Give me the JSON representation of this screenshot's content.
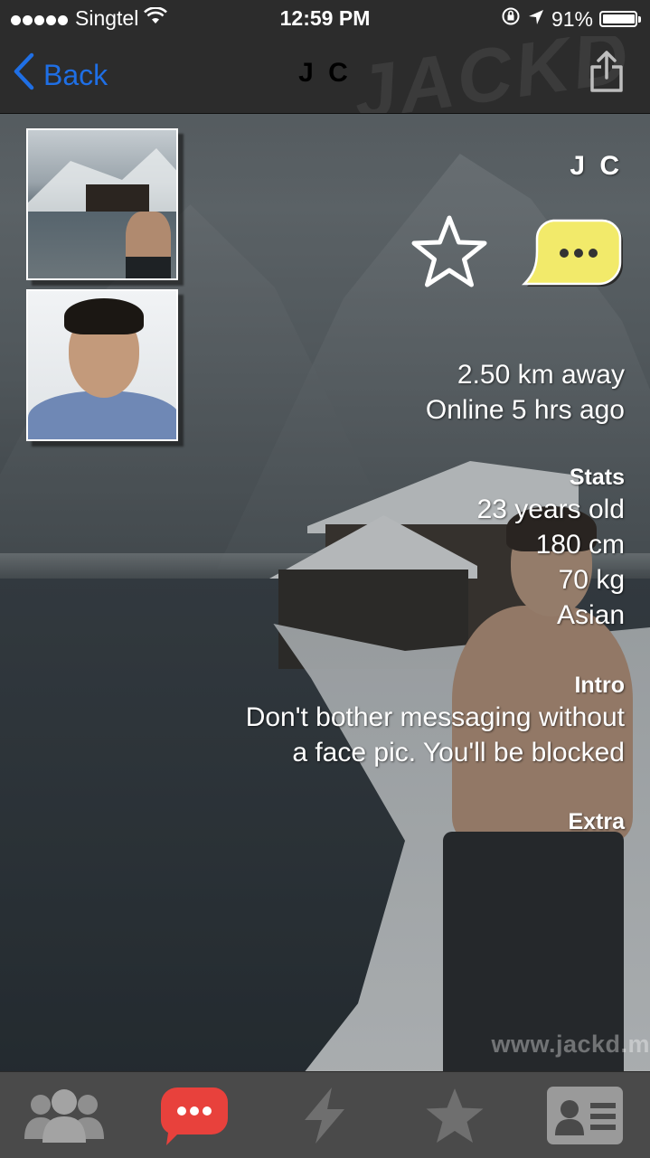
{
  "status_bar": {
    "carrier": "Singtel",
    "time": "12:59 PM",
    "battery_percent": "91%",
    "battery_level": 0.91,
    "icons": [
      "signal-dots-icon",
      "wifi-icon",
      "orientation-lock-icon",
      "location-arrow-icon",
      "battery-icon"
    ]
  },
  "navbar": {
    "back_label": "Back",
    "title": "J C",
    "logo_text": "JACKD",
    "share_icon": "share-icon"
  },
  "profile": {
    "name": "J C",
    "thumbnails": [
      "photo-lake-shirtless",
      "photo-selfie"
    ],
    "distance": "2.50 km away",
    "online": "Online 5 hrs ago",
    "stats_heading": "Stats",
    "stats": [
      "23 years old",
      "180 cm",
      "70 kg",
      "Asian"
    ],
    "intro_heading": "Intro",
    "intro_lines": [
      "Don't bother messaging without",
      "a face pic. You'll be blocked"
    ],
    "extra_heading": "Extra"
  },
  "watermark": "www.jackd.m",
  "tabbar": {
    "tabs": [
      "people-icon",
      "chat-icon",
      "lightning-icon",
      "star-icon",
      "profile-card-icon"
    ],
    "active_tab": "chat-icon"
  },
  "colors": {
    "accent_blue": "#1f6fe5",
    "chat_yellow": "#f2ea6a",
    "chat_tab_red": "#e8413c",
    "bar_background": "#2c2c2c",
    "tabbar_background": "#4a4a4a"
  }
}
